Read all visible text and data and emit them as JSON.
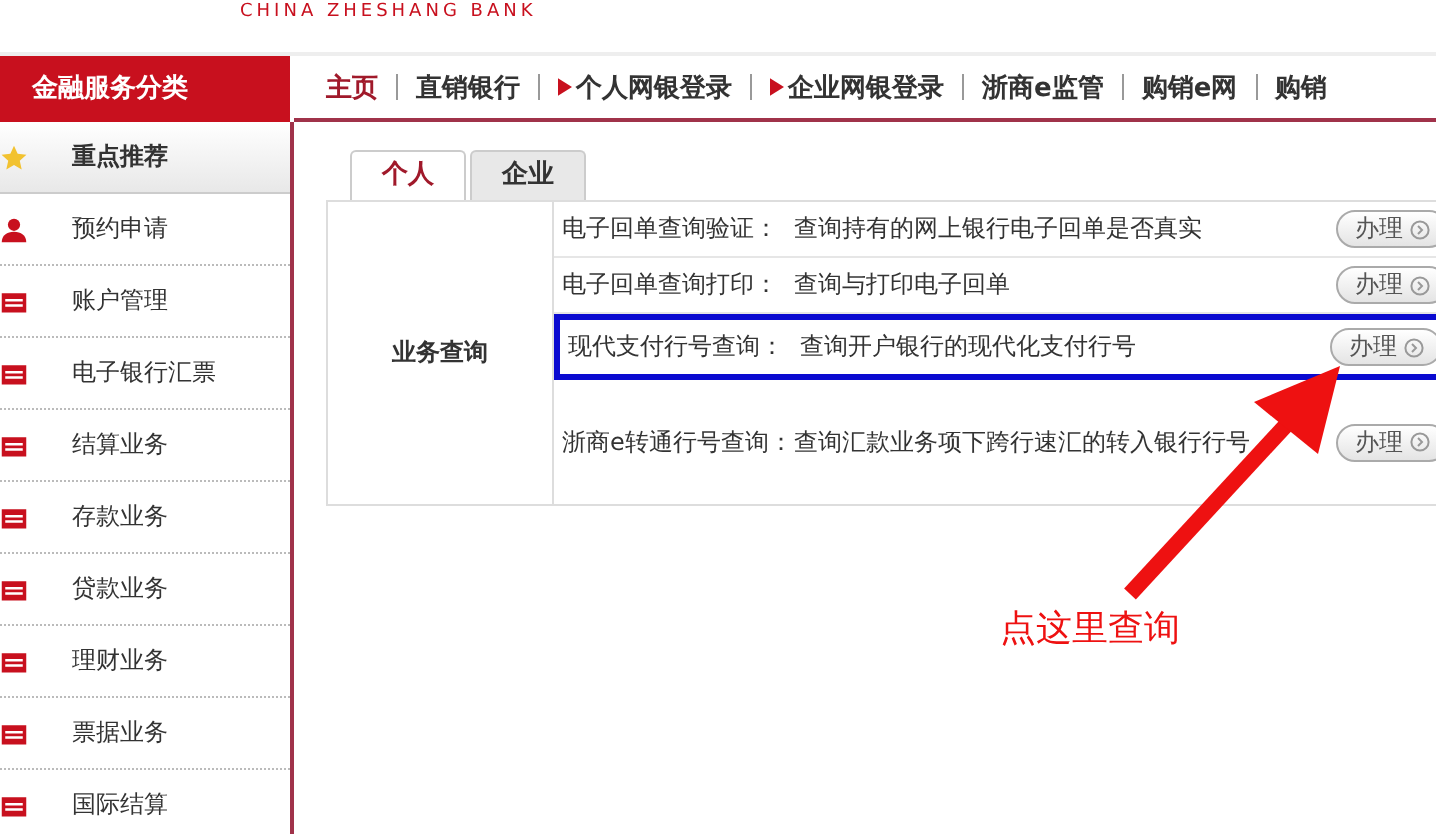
{
  "logo": {
    "text": "CHINA ZHESHANG BANK"
  },
  "sidebar": {
    "title": "金融服务分类",
    "items": [
      {
        "label": "重点推荐",
        "selected": true
      },
      {
        "label": "预约申请",
        "selected": false
      },
      {
        "label": "账户管理",
        "selected": false
      },
      {
        "label": "电子银行汇票",
        "selected": false
      },
      {
        "label": "结算业务",
        "selected": false
      },
      {
        "label": "存款业务",
        "selected": false
      },
      {
        "label": "贷款业务",
        "selected": false
      },
      {
        "label": "理财业务",
        "selected": false
      },
      {
        "label": "票据业务",
        "selected": false
      },
      {
        "label": "国际结算",
        "selected": false
      }
    ]
  },
  "nav": [
    {
      "label": "主页",
      "selected": true,
      "marker": false
    },
    {
      "label": "直销银行",
      "selected": false,
      "marker": false
    },
    {
      "label": "个人网银登录",
      "selected": false,
      "marker": true
    },
    {
      "label": "企业网银登录",
      "selected": false,
      "marker": true
    },
    {
      "label": "浙商e监管",
      "selected": false,
      "marker": false
    },
    {
      "label": "购销e网",
      "selected": false,
      "marker": false
    },
    {
      "label": "购销",
      "selected": false,
      "marker": false
    }
  ],
  "tabs": [
    {
      "label": "个人",
      "selected": true
    },
    {
      "label": "企业",
      "selected": false
    }
  ],
  "section": {
    "title": "业务查询",
    "rows": [
      {
        "name": "电子回单查询验证：",
        "description": "查询持有的网上银行电子回单是否真实",
        "button": "办理",
        "highlighted": false
      },
      {
        "name": "电子回单查询打印：",
        "description": "查询与打印电子回单",
        "button": "办理",
        "highlighted": false
      },
      {
        "name": "现代支付行号查询：",
        "description": "查询开户银行的现代化支付行号",
        "button": "办理",
        "highlighted": true
      },
      {
        "name": "浙商e转通行号查询：",
        "description": "查询汇款业务项下跨行速汇的转入银行行号",
        "button": "办理",
        "highlighted": false
      }
    ]
  },
  "annotation": {
    "text": "点这里查询"
  }
}
